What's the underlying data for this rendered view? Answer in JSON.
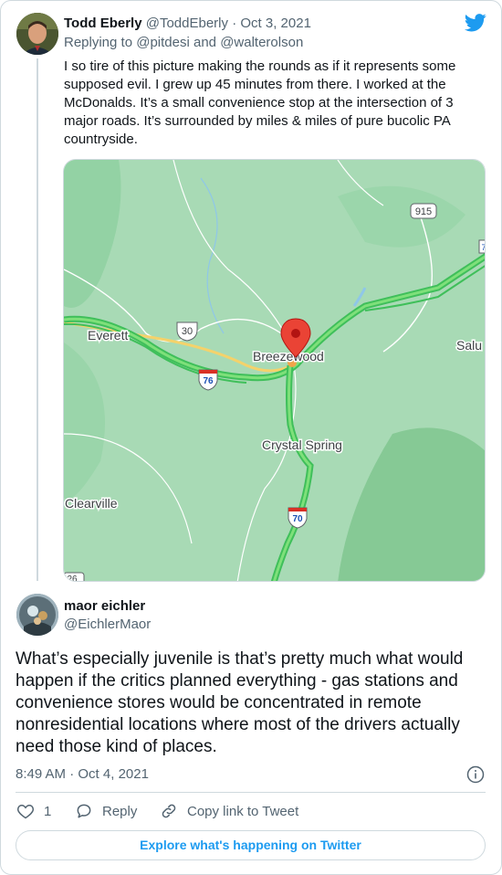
{
  "tweet1": {
    "author_name": "Todd Eberly",
    "author_handle": "@ToddEberly",
    "separator": "·",
    "date": "Oct 3, 2021",
    "replying_prefix": "Replying to",
    "replying_user1": "@pitdesi",
    "replying_and": "and",
    "replying_user2": "@walterolson",
    "text": "I so tire of this picture making the rounds as if it represents some supposed evil. I grew up 45 minutes from there. I worked at the McDonalds. It’s a small convenience stop at the intersection of 3 major roads. It’s surrounded by miles & miles of pure bucolic PA countryside."
  },
  "map": {
    "labels": {
      "everett": "Everett",
      "breezewood": "Breezewood",
      "crystal_spring": "Crystal Spring",
      "clearville": "Clearville",
      "salu": "Salu"
    },
    "shields": {
      "r915": "915",
      "r30": "30",
      "i76": "76",
      "i70": "70",
      "r26": "26",
      "r7": "7"
    },
    "colors": {
      "land": "#a8dab5",
      "forest": "#8fcf9f",
      "water": "#aadaff",
      "highway": "#5fd35f",
      "road_white": "#ffffff",
      "pin": "#ea4335"
    },
    "icons": [
      "location-pin-icon",
      "interstate-shield-icon",
      "us-route-shield-icon",
      "state-route-shield-icon"
    ]
  },
  "tweet2": {
    "author_name": "maor eichler",
    "author_handle": "@EichlerMaor",
    "text": "What’s especially juvenile is that’s pretty much what would happen if the critics planned everything - gas stations and convenience stores would be concentrated in remote nonresidential locations where most of the drivers actually need those kind of places.",
    "time": "8:49 AM",
    "separator": "·",
    "date": "Oct 4, 2021"
  },
  "actions": {
    "like_count": "1",
    "reply_label": "Reply",
    "copy_label": "Copy link to Tweet"
  },
  "explore_label": "Explore what's happening on Twitter",
  "colors": {
    "accent": "#1d9bf0",
    "muted_text": "#536471",
    "border": "#cfd9de"
  }
}
